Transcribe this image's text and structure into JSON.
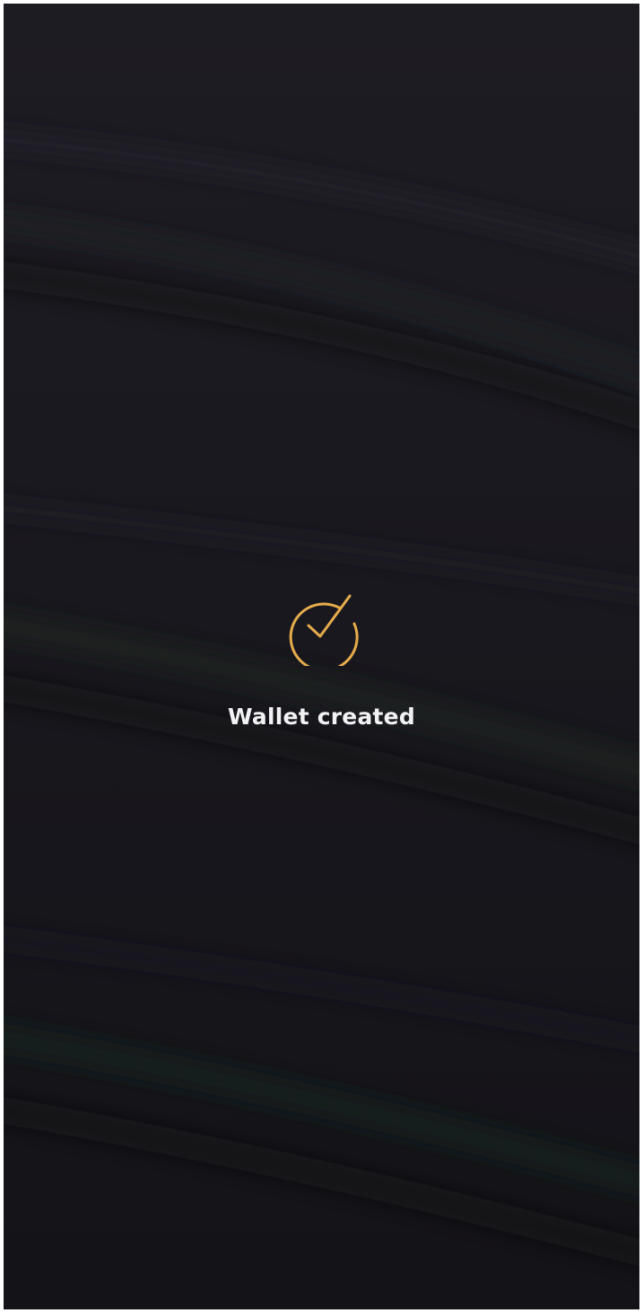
{
  "status": {
    "title": "Wallet created",
    "icon": "check-circle-icon",
    "accent_color": "#e6ac4c"
  }
}
